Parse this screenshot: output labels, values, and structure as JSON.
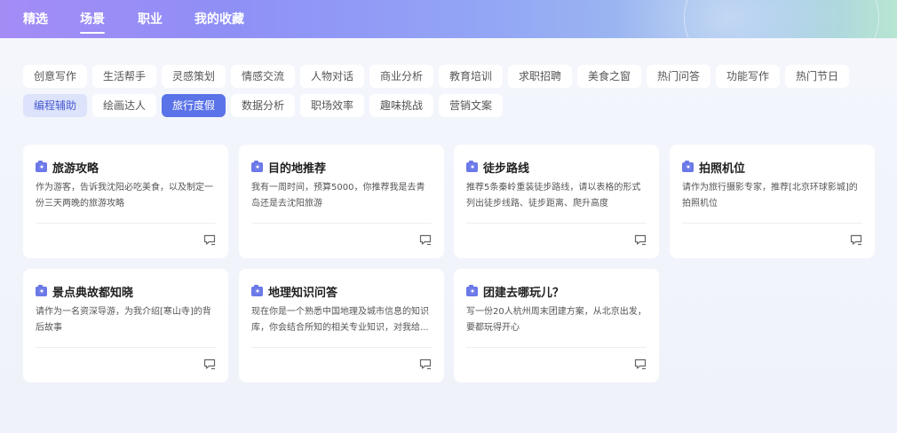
{
  "nav": {
    "tabs": [
      {
        "label": "精选"
      },
      {
        "label": "场景"
      },
      {
        "label": "职业"
      },
      {
        "label": "我的收藏"
      }
    ],
    "active_index": 1
  },
  "categories": [
    "创意写作",
    "生活帮手",
    "灵感策划",
    "情感交流",
    "人物对话",
    "商业分析",
    "教育培训",
    "求职招聘",
    "美食之窗",
    "热门问答",
    "功能写作",
    "热门节日",
    "编程辅助",
    "绘画达人",
    "旅行度假",
    "数据分析",
    "职场效率",
    "趣味挑战",
    "营销文案"
  ],
  "selected_category": "旅行度假",
  "cards": [
    {
      "title": "旅游攻略",
      "desc": "作为游客，告诉我沈阳必吃美食，以及制定一份三天两晚的旅游攻略"
    },
    {
      "title": "目的地推荐",
      "desc": "我有一周时间，预算5000，你推荐我是去青岛还是去沈阳旅游"
    },
    {
      "title": "徒步路线",
      "desc": "推荐5条秦岭重装徒步路线，请以表格的形式列出徒步线路、徒步距离、爬升高度"
    },
    {
      "title": "拍照机位",
      "desc": "请作为旅行摄影专家，推荐[北京环球影城]的拍照机位"
    },
    {
      "title": "景点典故都知晓",
      "desc": "请作为一名资深导游，为我介绍[寒山寺]的背后故事"
    },
    {
      "title": "地理知识问答",
      "desc": "现在你是一个熟悉中国地理及城市信息的知识库，你会结合所知的相关专业知识，对我给..."
    },
    {
      "title": "团建去哪玩儿？",
      "desc": "写一份20人杭州周末团建方案，从北京出发，要都玩得开心"
    }
  ],
  "colors": {
    "accent": "#5b73e8",
    "soft_chip": "#dce3fb",
    "icon": "#6b79e8"
  },
  "icons": {
    "card_title": "camera-icon",
    "card_action": "chat-icon"
  }
}
